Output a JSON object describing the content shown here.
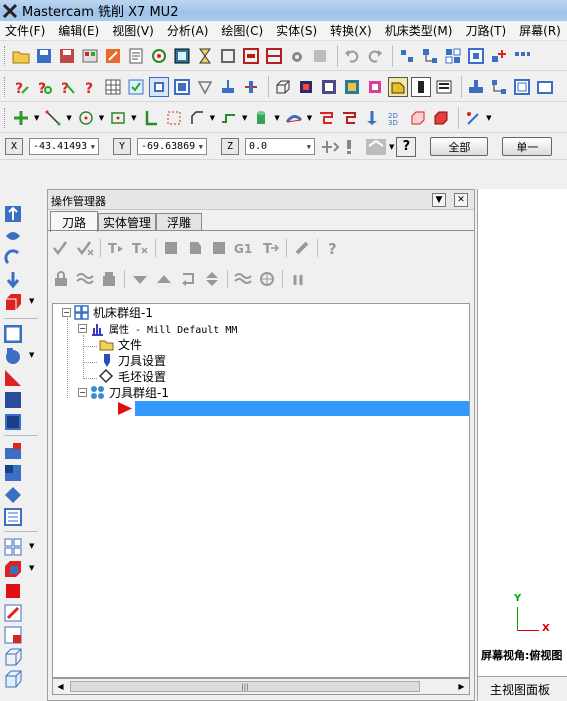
{
  "window": {
    "title": "Mastercam 铣削 X7 MU2"
  },
  "menu": [
    "文件(F)",
    "编辑(E)",
    "视图(V)",
    "分析(A)",
    "绘图(C)",
    "实体(S)",
    "转换(X)",
    "机床类型(M)",
    "刀路(T)",
    "屏幕(R)"
  ],
  "coords": {
    "x_label": "X",
    "x_value": "-43.41493",
    "y_label": "Y",
    "y_value": "-69.63869",
    "z_label": "Z",
    "z_value": "0.0",
    "all_button": "全部",
    "single_button": "单一"
  },
  "panel": {
    "title": "操作管理器",
    "tabs": [
      "刀路",
      "实体管理",
      "浮雕"
    ],
    "tree": {
      "machine_group": "机床群组-1",
      "properties": "属性 - Mill Default MM",
      "files": "文件",
      "tool_settings": "刀具设置",
      "stock_settings": "毛坯设置",
      "toolpath_group": "刀具群组-1"
    }
  },
  "graphics": {
    "axis_y": "Y",
    "axis_x": "X",
    "view_label": "屏幕视角:俯视图",
    "view_panel": "主视图面板"
  },
  "colors": {
    "selection": "#3399ff",
    "axis_x": "#dd0000",
    "axis_y": "#00aa00"
  }
}
